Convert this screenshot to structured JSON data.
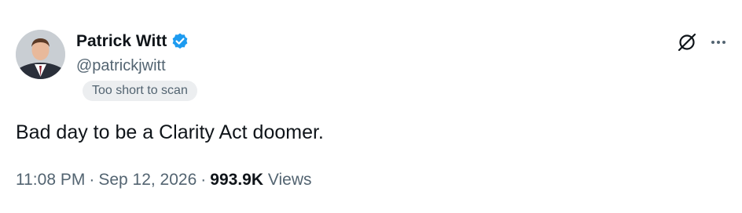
{
  "author": {
    "display_name": "Patrick Witt",
    "handle": "@patrickjwitt",
    "verified": true
  },
  "badge": {
    "label": "Too short to scan"
  },
  "tweet": {
    "text": "Bad day to be a Clarity Act doomer."
  },
  "meta": {
    "time": "11:08 PM",
    "separator": "·",
    "date": "Sep 12, 2026",
    "views_count": "993.9K",
    "views_label": "Views"
  },
  "icons": {
    "verified": "verified-badge-icon",
    "top_right_1": "no-signal-circle-slash-icon",
    "top_right_2": "more-options-ellipsis-icon"
  },
  "colors": {
    "verified_blue": "#1d9bf0",
    "secondary_text": "#536471",
    "primary_text": "#0f1419",
    "badge_bg": "#eceef0"
  }
}
